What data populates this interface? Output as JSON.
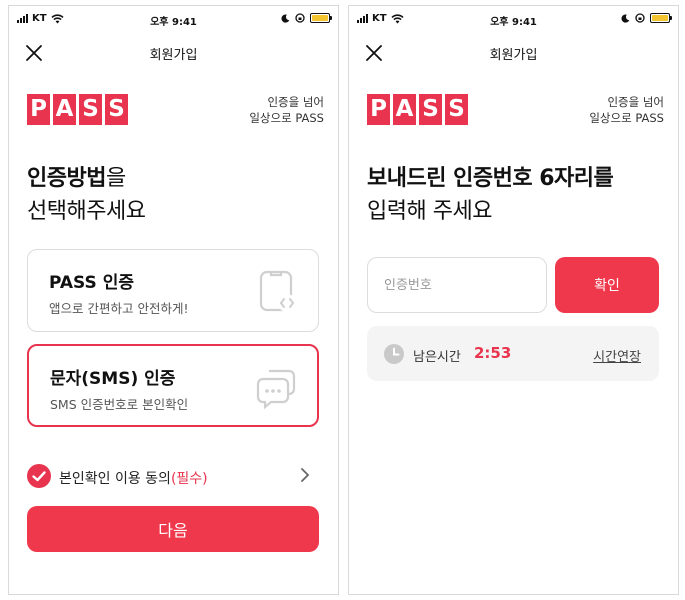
{
  "status_bar": {
    "carrier": "KT",
    "time": "오후 9:41"
  },
  "left_screen": {
    "nav_title": "회원가입",
    "brand": {
      "logo_letters": [
        "P",
        "A",
        "S",
        "S"
      ],
      "slogan_line1": "인증을 넘어",
      "slogan_line2": "일상으로 PASS"
    },
    "headline": {
      "line1_bold": "인증방법",
      "line1_rest": "을",
      "line2": "선택해주세요"
    },
    "cards": [
      {
        "title": "PASS 인증",
        "desc": "앱으로 간편하고 안전하게!",
        "icon": "phone-code-icon",
        "selected": false
      },
      {
        "title": "문자(SMS) 인증",
        "desc": "SMS 인증번호로 본인확인",
        "icon": "chat-bubbles-icon",
        "selected": true
      }
    ],
    "agreement": {
      "text": "본인확인 이용 동의",
      "required": "(필수)",
      "checked": true
    },
    "next_label": "다음"
  },
  "right_screen": {
    "nav_title": "회원가입",
    "brand": {
      "logo_letters": [
        "P",
        "A",
        "S",
        "S"
      ],
      "slogan_line1": "인증을 넘어",
      "slogan_line2": "일상으로 PASS"
    },
    "headline": {
      "line1": "보내드린 인증번호 6자리를",
      "line2": "입력해 주세요"
    },
    "code_input": {
      "placeholder": "인증번호",
      "value": ""
    },
    "confirm_label": "확인",
    "timer": {
      "label": "남은시간",
      "value": "2:53",
      "extend_label": "시간연장"
    }
  },
  "colors": {
    "accent": "#e8344e",
    "button": "#f0384d",
    "battery": "#f4c430"
  }
}
